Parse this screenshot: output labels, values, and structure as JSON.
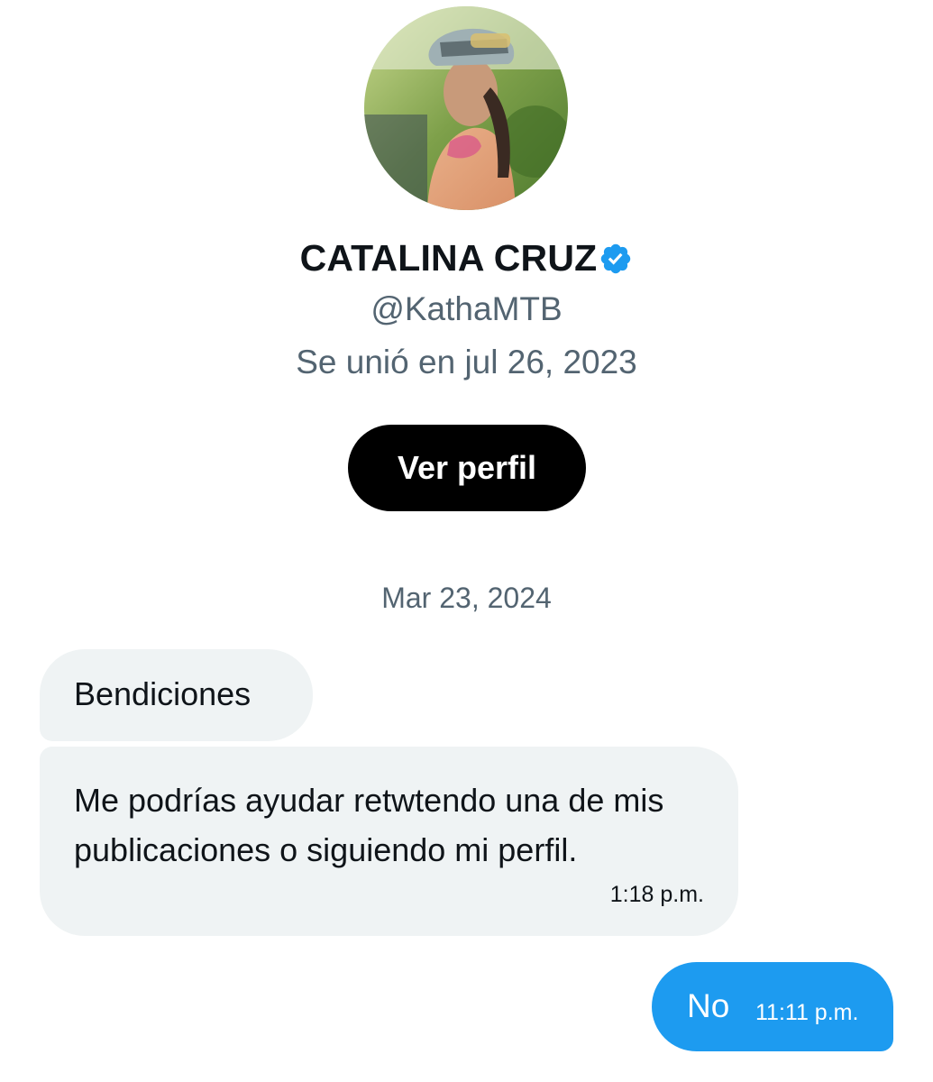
{
  "profile": {
    "name": "CATALINA CRUZ",
    "handle": "@KathaMTB",
    "joined": "Se unió en jul 26, 2023",
    "verified": true,
    "view_profile_label": "Ver perfil"
  },
  "conversation": {
    "date_separator": "Mar 23, 2024",
    "messages": [
      {
        "direction": "incoming",
        "text": "Bendiciones",
        "time": ""
      },
      {
        "direction": "incoming",
        "text": "Me podrías ayudar retwtendo una de mis publicaciones o siguiendo mi perfil.",
        "time": "1:18 p.m."
      },
      {
        "direction": "outgoing",
        "text": "No",
        "time": "11:11 p.m."
      }
    ]
  },
  "colors": {
    "accent": "#1d9bf0",
    "incoming_bubble": "#eff3f4",
    "secondary_text": "#536471",
    "button_bg": "#000000"
  },
  "icons": {
    "verified": "verified-badge-icon"
  }
}
